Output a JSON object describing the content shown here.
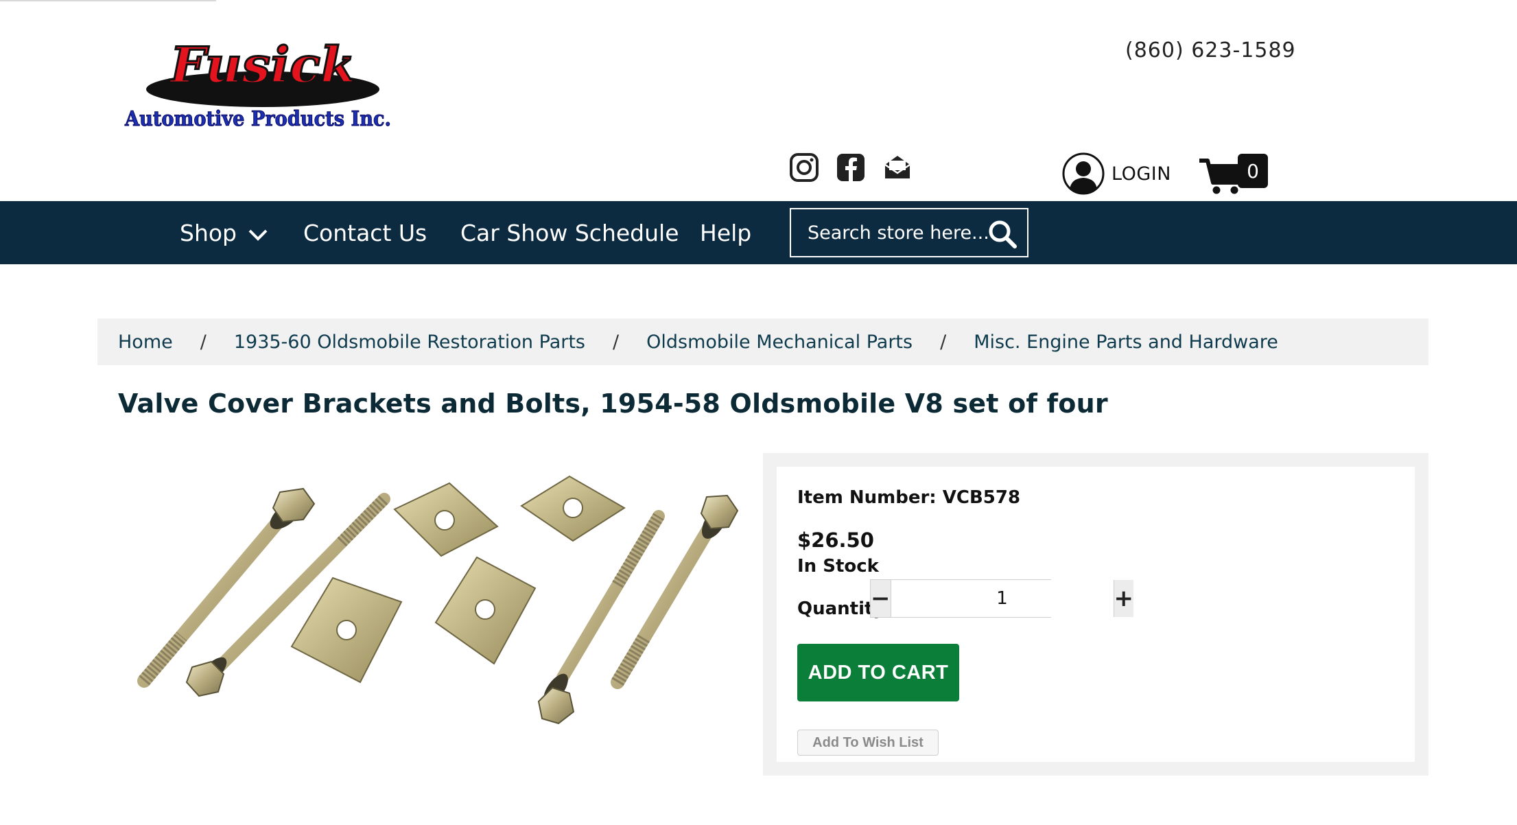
{
  "header": {
    "logo": {
      "brand": "Fusick",
      "tagline": "Automotive Products Inc."
    },
    "phone": "(860) 623-1589",
    "social_icons": [
      "instagram-icon",
      "facebook-icon",
      "email-icon"
    ],
    "login_label": "LOGIN",
    "cart_count": "0"
  },
  "nav": {
    "items": [
      {
        "label": "Shop",
        "has_dropdown": true
      },
      {
        "label": "Contact Us"
      },
      {
        "label": "Car Show Schedule"
      },
      {
        "label": "Help"
      }
    ],
    "search_placeholder": "Search store here..."
  },
  "breadcrumb": {
    "items": [
      "Home",
      "1935-60 Oldsmobile Restoration Parts",
      "Oldsmobile Mechanical Parts",
      "Misc. Engine Parts and Hardware"
    ],
    "separator": "/"
  },
  "product": {
    "title": "Valve Cover Brackets and Bolts, 1954-58 Oldsmobile V8 set of four",
    "item_number": "Item Number: VCB578",
    "price": "$26.50",
    "stock": "In Stock",
    "quantity_label": "Quantity",
    "quantity_value": "1",
    "minus_symbol": "−",
    "plus_symbol": "+",
    "add_to_cart_label": "ADD TO CART",
    "wish_list_label": "Add To Wish List"
  },
  "colors": {
    "nav_bg": "#0d2b40",
    "add_to_cart": "#0b7f3a",
    "logo_red": "#e3141d",
    "logo_blue": "#1c2fb0",
    "breadcrumb_link": "#0d3a4c"
  }
}
